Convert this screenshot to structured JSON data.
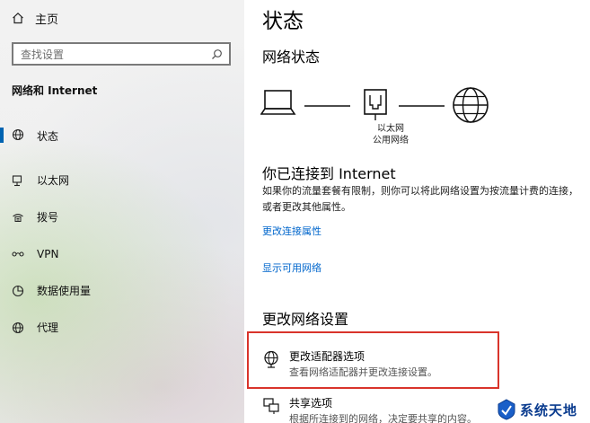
{
  "sidebar": {
    "home_label": "主页",
    "search_placeholder": "查找设置",
    "section_title": "网络和 Internet",
    "items": [
      {
        "label": "状态",
        "icon": "globe-status-icon"
      },
      {
        "label": "以太网",
        "icon": "ethernet-icon"
      },
      {
        "label": "拨号",
        "icon": "dialup-icon"
      },
      {
        "label": "VPN",
        "icon": "vpn-icon"
      },
      {
        "label": "数据使用量",
        "icon": "data-usage-icon"
      },
      {
        "label": "代理",
        "icon": "proxy-globe-icon"
      }
    ],
    "selected_index": 0,
    "accent_color": "#0063b1"
  },
  "main": {
    "title": "状态",
    "network_status_heading": "网络状态",
    "device_label_line1": "以太网",
    "device_label_line2": "公用网络",
    "connected_heading": "你已连接到 Internet",
    "connected_description": "如果你的流量套餐有限制，则你可以将此网络设置为按流量计费的连接，或者更改其他属性。",
    "link_change_properties": "更改连接属性",
    "link_show_networks": "显示可用网络",
    "change_settings_heading": "更改网络设置",
    "options": [
      {
        "title": "更改适配器选项",
        "description": "查看网络适配器并更改连接设置。",
        "icon": "adapter-globe-icon"
      },
      {
        "title": "共享选项",
        "description": "根据所连接到的网络，决定要共享的内容。",
        "icon": "sharing-icon"
      }
    ],
    "link_color": "#0066cc",
    "highlight_color": "#d9342b"
  },
  "watermark": {
    "text": "系统天地",
    "color": "#0b3c8f"
  }
}
